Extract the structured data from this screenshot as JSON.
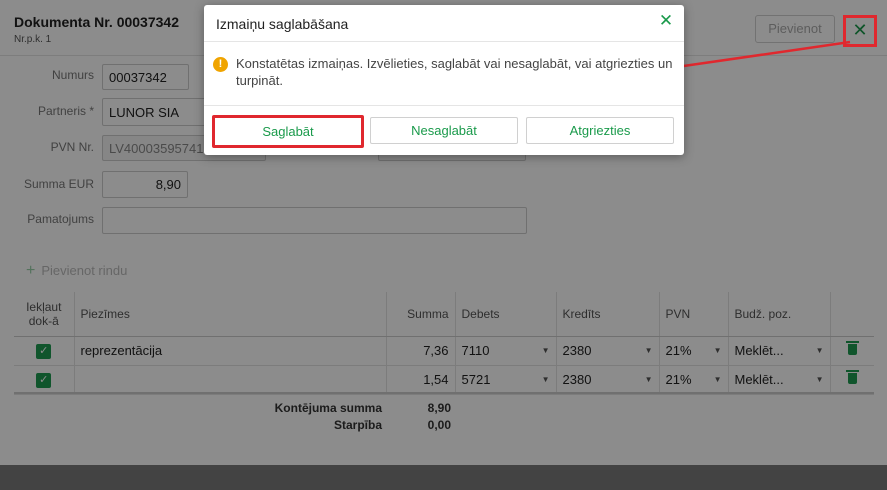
{
  "header": {
    "title": "Dokumenta Nr. 00037342",
    "subtitle": "Nr.p.k. 1",
    "add_button": "Pievienot",
    "close_icon": "close-icon"
  },
  "form": {
    "number_label": "Numurs",
    "number_value": "00037342",
    "partner_label": "Partneris *",
    "partner_value": "LUNOR SIA",
    "vat_label": "PVN Nr.",
    "vat_value": "LV40003595741",
    "sum_label": "Summa EUR",
    "sum_value": "8,90",
    "basis_label": "Pamatojums",
    "basis_value": ""
  },
  "add_row_label": "Pievienot rindu",
  "table": {
    "headers": {
      "include": "Iekļaut dok-ā",
      "notes": "Piezīmes",
      "sum": "Summa",
      "debit": "Debets",
      "credit": "Kredīts",
      "vat": "PVN",
      "budget": "Budž. poz."
    },
    "rows": [
      {
        "checked": true,
        "notes": "reprezentācija",
        "sum": "7,36",
        "debit": "7110",
        "credit": "2380",
        "vat": "21%",
        "budget": "Meklēt..."
      },
      {
        "checked": true,
        "notes": "",
        "sum": "1,54",
        "debit": "5721",
        "credit": "2380",
        "vat": "21%",
        "budget": "Meklēt..."
      }
    ]
  },
  "totals": {
    "sum_label": "Kontējuma summa",
    "sum_value": "8,90",
    "diff_label": "Starpība",
    "diff_value": "0,00"
  },
  "modal": {
    "title": "Izmaiņu saglabāšana",
    "message": "Konstatētas izmaiņas. Izvēlieties, saglabāt vai nesaglabāt, vai atgriezties un turpināt.",
    "save": "Saglabāt",
    "dont_save": "Nesaglabāt",
    "return": "Atgriezties"
  },
  "colors": {
    "accent": "#1a9a4b",
    "highlight": "#e0282e",
    "warning": "#f0a400"
  }
}
